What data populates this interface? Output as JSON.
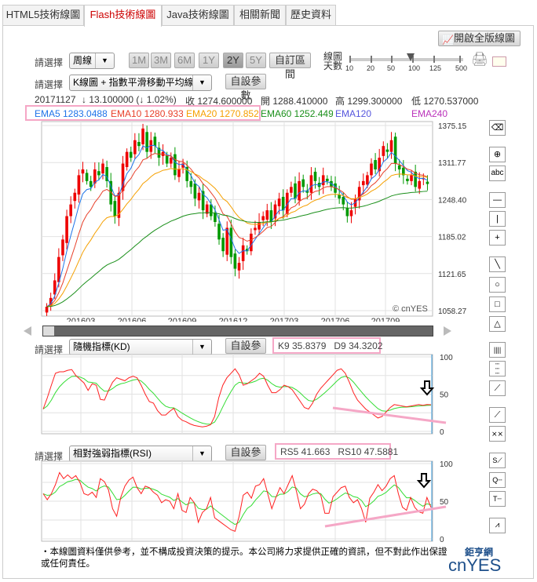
{
  "tabs": [
    {
      "label": "HTML5技術線圖"
    },
    {
      "label": "Flash技術線圖"
    },
    {
      "label": "Java技術線圖"
    },
    {
      "label": "相關新聞"
    },
    {
      "label": "歷史資料"
    }
  ],
  "fullscreen_button": "開啟全版線圖",
  "controls": {
    "select_label": "請選擇",
    "period_value": "周線",
    "ranges": [
      "1M",
      "3M",
      "6M",
      "1Y",
      "2Y",
      "5Y"
    ],
    "selected_range": "2Y",
    "custom_range": "自訂區間",
    "days_label_1": "線圖",
    "days_label_2": "天數",
    "days_ticks": [
      "10",
      "20",
      "50",
      "100",
      "125",
      "500"
    ],
    "days_selected": "100",
    "chart_type_value": "K線圖 + 指數平滑移動平均線",
    "param_button": "自設參數"
  },
  "quote": {
    "date": "20171127",
    "change": "↓ 13.100000 (↓ 1.02%)",
    "close": "收 1274.600000",
    "open": "開 1288.410000",
    "high": "高 1299.300000",
    "low": "低 1270.537000"
  },
  "ema": [
    {
      "label": "EMA5 1283.0488",
      "color": "#1e73e8"
    },
    {
      "label": "EMA10 1280.9332",
      "color": "#e8402a"
    },
    {
      "label": "EMA20 1270.8524",
      "color": "#f5a000"
    },
    {
      "label": "EMA60 1252.4494",
      "color": "#1a8f1a"
    },
    {
      "label": "EMA120",
      "color": "#5555dd"
    },
    {
      "label": "EMA240",
      "color": "#bb33bb"
    }
  ],
  "watermark": "© cnYES",
  "chart_data": [
    {
      "type": "candlestick",
      "title": "K線圖 + 指數平滑移動平均線",
      "ylim": [
        1058.27,
        1375.15
      ],
      "yticks": [
        "1375.15",
        "1311.77",
        "1248.40",
        "1185.02",
        "1121.65",
        "1058.27"
      ],
      "xticks": [
        "201603",
        "201606",
        "201609",
        "201612",
        "201703",
        "201706",
        "201709"
      ],
      "closes": [
        1065,
        1080,
        1110,
        1150,
        1180,
        1220,
        1240,
        1260,
        1290,
        1300,
        1280,
        1270,
        1300,
        1290,
        1310,
        1280,
        1240,
        1220,
        1260,
        1310,
        1330,
        1320,
        1350,
        1340,
        1370,
        1330,
        1350,
        1340,
        1320,
        1330,
        1310,
        1320,
        1290,
        1300,
        1310,
        1280,
        1270,
        1250,
        1260,
        1230,
        1240,
        1220,
        1210,
        1180,
        1160,
        1200,
        1150,
        1130,
        1140,
        1170,
        1160,
        1190,
        1200,
        1210,
        1220,
        1230,
        1210,
        1240,
        1250,
        1230,
        1260,
        1270,
        1250,
        1280,
        1270,
        1260,
        1290,
        1280,
        1270,
        1290,
        1280,
        1270,
        1260,
        1250,
        1240,
        1220,
        1230,
        1250,
        1270,
        1280,
        1290,
        1310,
        1300,
        1320,
        1340,
        1330,
        1350,
        1310,
        1300,
        1290,
        1280,
        1290,
        1270,
        1280,
        1285,
        1275
      ]
    },
    {
      "type": "line",
      "title": "隨機指標(KD)",
      "ylim": [
        0,
        100
      ],
      "yticks": [
        "100",
        "50",
        "0"
      ],
      "series": [
        {
          "name": "K9",
          "color": "#ff2020",
          "values": [
            30,
            45,
            62,
            78,
            80,
            80,
            82,
            83,
            75,
            70,
            65,
            55,
            64,
            62,
            43,
            42,
            55,
            66,
            72,
            70,
            68,
            72,
            74,
            72,
            62,
            50,
            40,
            38,
            28,
            22,
            22,
            27,
            31,
            20,
            15,
            13,
            10,
            8,
            7,
            6,
            7,
            9,
            20,
            45,
            62,
            72,
            78,
            84,
            76,
            62,
            64,
            68,
            72,
            78,
            74,
            62,
            52,
            52,
            56,
            62,
            60,
            56,
            48,
            40,
            32,
            30,
            38,
            50,
            58,
            64,
            70,
            76,
            82,
            84,
            78,
            66,
            52,
            42,
            36,
            30,
            26,
            22,
            18,
            20,
            26,
            32,
            36,
            35,
            34,
            33,
            34,
            35,
            36,
            35,
            36,
            35.8
          ]
        },
        {
          "name": "D9",
          "color": "#33dd33"
        }
      ],
      "annotation": "down-arrow"
    },
    {
      "type": "line",
      "title": "相對強弱指標(RSI)",
      "ylim": [
        0,
        100
      ],
      "yticks": [
        "100",
        "50",
        "0"
      ],
      "series": [
        {
          "name": "RS5",
          "color": "#ff2020",
          "values": [
            60,
            52,
            60,
            72,
            88,
            80,
            85,
            80,
            84,
            75,
            60,
            58,
            62,
            55,
            80,
            76,
            65,
            40,
            30,
            55,
            70,
            78,
            82,
            68,
            60,
            70,
            68,
            62,
            58,
            48,
            52,
            50,
            40,
            60,
            38,
            35,
            55,
            48,
            22,
            35,
            40,
            55,
            28,
            24,
            20,
            16,
            12,
            10,
            30,
            58,
            62,
            54,
            70,
            72,
            80,
            60,
            40,
            55,
            68,
            60,
            72,
            84,
            64,
            40,
            46,
            60,
            66,
            64,
            58,
            34,
            34,
            56,
            62,
            68,
            70,
            55,
            48,
            52,
            40,
            22,
            54,
            62,
            72,
            64,
            70,
            80,
            84,
            60,
            42,
            38,
            55,
            42,
            36,
            34,
            55,
            41.7
          ]
        },
        {
          "name": "RS10",
          "color": "#33dd33"
        }
      ],
      "annotation": "down-arrow"
    }
  ],
  "kd_panel": {
    "select_value": "隨機指標(KD)",
    "values": "K9 35.8379   D9 34.3202"
  },
  "rsi_panel": {
    "select_value": "相對強弱指標(RSI)",
    "values": "RS5 41.663   RS10 47.5881"
  },
  "footer": {
    "line1": "・本線圖資料僅供參考，並不構成投資決策的提示。本公司將力求提供正確的資訊，但不對此作出保證",
    "line2": "或任何責任。"
  },
  "logo": {
    "cn": "鉅亨網",
    "en": "cnYES"
  }
}
